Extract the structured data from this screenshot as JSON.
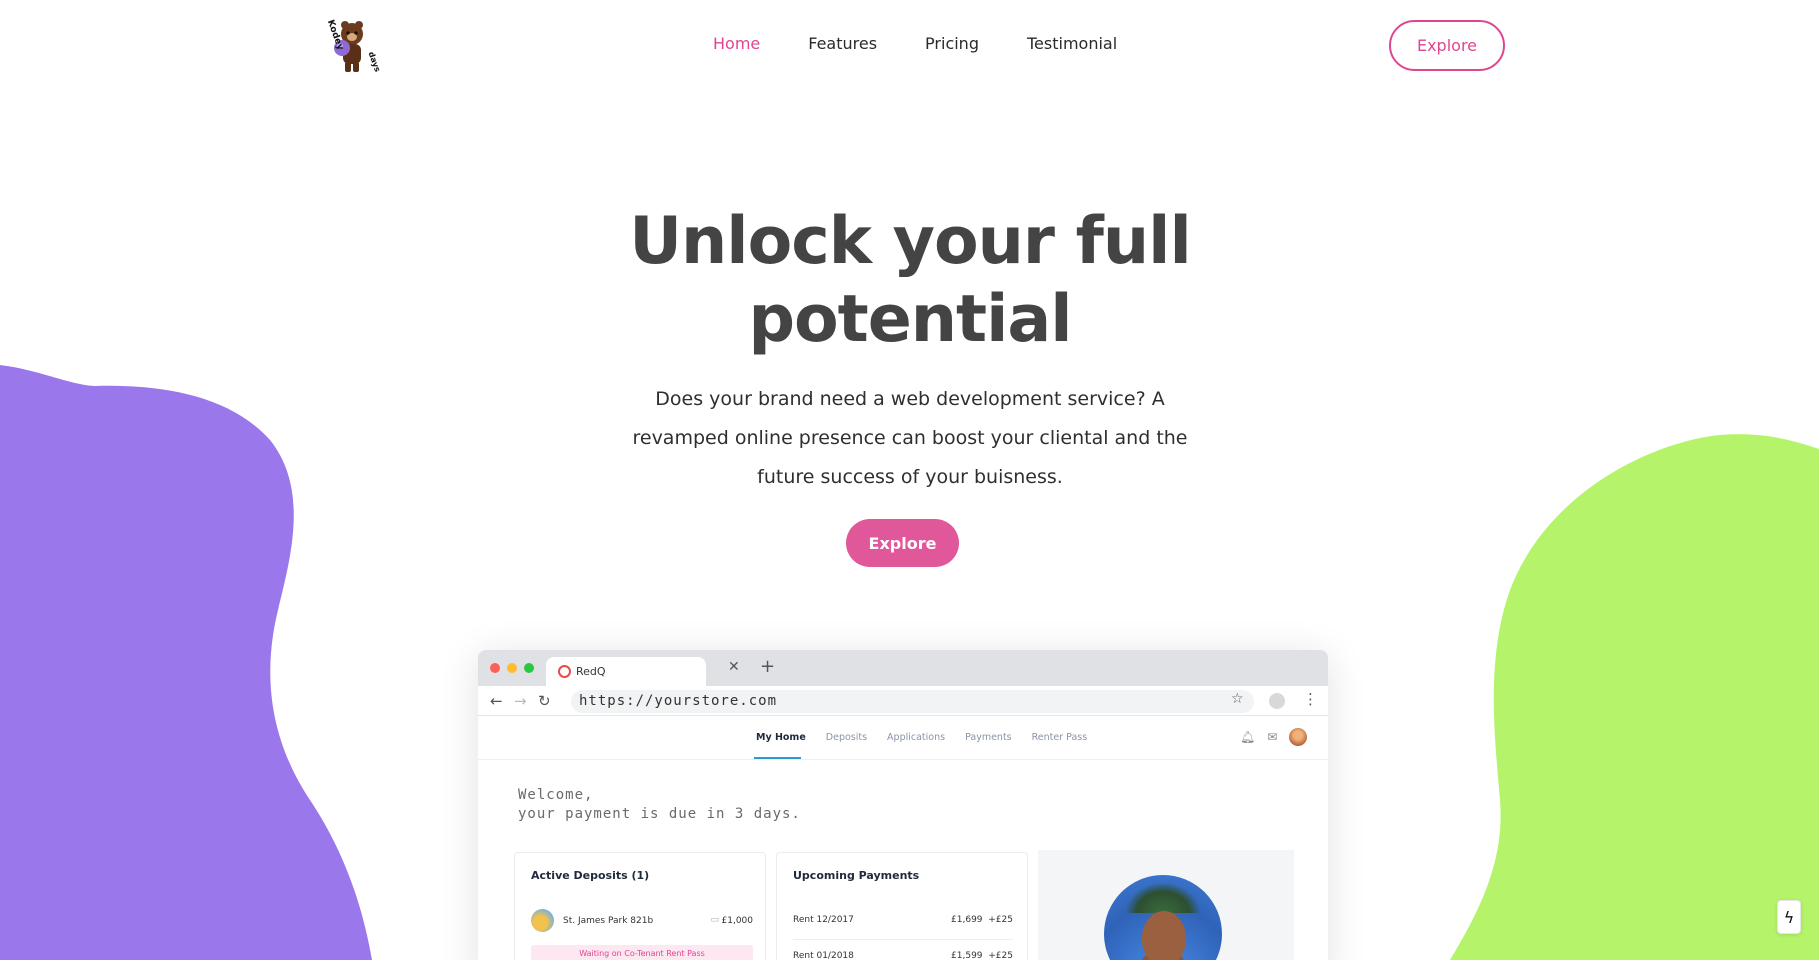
{
  "nav": {
    "logo_text_top": "Kodey",
    "logo_text_bottom": "days",
    "links": [
      {
        "label": "Home",
        "active": true
      },
      {
        "label": "Features",
        "active": false
      },
      {
        "label": "Pricing",
        "active": false
      },
      {
        "label": "Testimonial",
        "active": false
      }
    ],
    "cta_label": "Explore"
  },
  "hero": {
    "title_line1": "Unlock your full",
    "title_line2": "potential",
    "subtitle_line1": "Does your brand need a web development service? A",
    "subtitle_line2": "revamped online presence can boost your cliental and the",
    "subtitle_line3": "future success of your buisness.",
    "cta_label": "Explore"
  },
  "mockup": {
    "browser": {
      "tab_title": "RedQ",
      "url": "https://yourstore.com"
    },
    "app_tabs": [
      "My Home",
      "Deposits",
      "Applications",
      "Payments",
      "Renter Pass"
    ],
    "welcome_line1": "Welcome,",
    "welcome_line2": "your payment is due in 3 days.",
    "active_deposits": {
      "title": "Active Deposits (1)",
      "item_name": "St. James Park 821b",
      "item_amount": "£1,000",
      "status": "Waiting on Co-Tenant Rent Pass"
    },
    "upcoming_payments": {
      "title": "Upcoming Payments",
      "rows": [
        {
          "label": "Rent 12/2017",
          "amount": "£1,699",
          "extra": "+£25"
        },
        {
          "label": "Rent 01/2018",
          "amount": "£1,599",
          "extra": "+£25"
        }
      ]
    }
  },
  "colors": {
    "accent_pink": "#e0468f",
    "blob_purple": "#9b77ec",
    "blob_green": "#b5f46a"
  },
  "icons": {
    "logo": "bear-mascot-icon",
    "lightning": "lightning-icon"
  }
}
